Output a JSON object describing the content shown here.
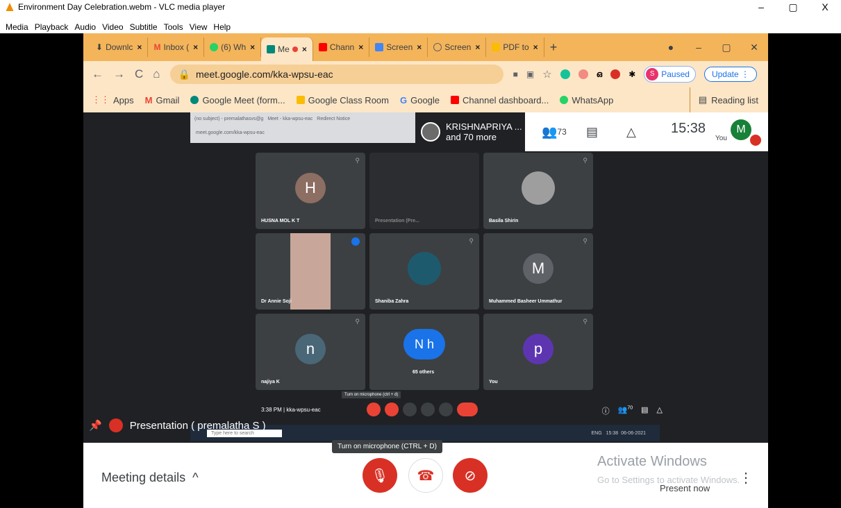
{
  "window": {
    "title": "Environment Day Celebration.webm - VLC media player",
    "controls": [
      "–",
      "▢",
      "X"
    ]
  },
  "menubar": [
    "Media",
    "Playback",
    "Audio",
    "Video",
    "Subtitle",
    "Tools",
    "View",
    "Help"
  ],
  "browser": {
    "tabs": [
      {
        "label": "Downlc",
        "color": "#3c4043"
      },
      {
        "label": "Inbox (",
        "color": "#ea4335"
      },
      {
        "label": "(6) Wh",
        "color": "#25d366"
      },
      {
        "label": "Me",
        "color": "#00897b"
      },
      {
        "label": "Chann",
        "color": "#ff0000"
      },
      {
        "label": "Screen",
        "color": "#4285f4"
      },
      {
        "label": "Screen",
        "color": "#5f6368"
      },
      {
        "label": "PDF to",
        "color": "#fbbc04"
      }
    ],
    "url": "meet.google.com/kka-wpsu-eac",
    "profile_initial": "S",
    "paused_label": "Paused",
    "update_label": "Update",
    "bookmarks": [
      {
        "label": "Apps",
        "color": "#ea4335"
      },
      {
        "label": "Gmail",
        "color": "#ea4335"
      },
      {
        "label": "Google Meet (form...",
        "color": "#00897b"
      },
      {
        "label": "Google Class Room",
        "color": "#fbbc04"
      },
      {
        "label": "Google",
        "color": "#4285f4"
      },
      {
        "label": "Channel dashboard...",
        "color": "#ff0000"
      },
      {
        "label": "WhatsApp",
        "color": "#25d366"
      }
    ],
    "reading_list": "Reading list"
  },
  "inner": {
    "tabs": [
      "(no subject) - premalathasvs@g",
      "Meet - kka-wpsu-eac",
      "Redirect Notice"
    ],
    "url": "meet.google.com/kka-wpsu-eac"
  },
  "overlay": {
    "presenter": "KRISHNAPRIYA ...",
    "presenter_sub": "and 70 more",
    "participants": "73",
    "time": "15:38",
    "me_initial": "M",
    "you": "You"
  },
  "tiles": [
    {
      "initial": "H",
      "name": "HUSNA MOL K T",
      "color": "#8d6e63"
    },
    {
      "initial": "",
      "name": "Presentation (Pre...",
      "color": "#3c4043"
    },
    {
      "initial": "",
      "name": "Basila Shirin",
      "color": "#9e9e9e"
    },
    {
      "initial": "",
      "name": "Dr Annie Soji",
      "color": "#c8a79a"
    },
    {
      "initial": "",
      "name": "Shaniba Zahra",
      "color": "#1e5a6e"
    },
    {
      "initial": "M",
      "name": "Muhammed Basheer Ummathur",
      "color": "#5f6368"
    },
    {
      "initial": "n",
      "name": "najiya K",
      "color": "#4a6778"
    },
    {
      "initial": "N h",
      "name": "65 others",
      "color": "#1a73e8"
    },
    {
      "initial": "p",
      "name": "You",
      "color": "#5e35b1"
    }
  ],
  "meetbar": {
    "time": "3:38 PM | kka-wpsu-eac",
    "tooltip": "Turn on microphone (ctrl + d)",
    "count": "70"
  },
  "taskbar": {
    "search": "Type here to search",
    "lang": "ENG",
    "clock": "15:38",
    "date": "06-06-2021"
  },
  "presentation_label": "Presentation ( premalatha S )",
  "bottom": {
    "meeting_details": "Meeting details",
    "mic_tooltip": "Turn on microphone (CTRL + D)",
    "activate_title": "Activate Windows",
    "activate_sub": "Go to Settings to activate Windows.",
    "present_now": "Present now"
  }
}
